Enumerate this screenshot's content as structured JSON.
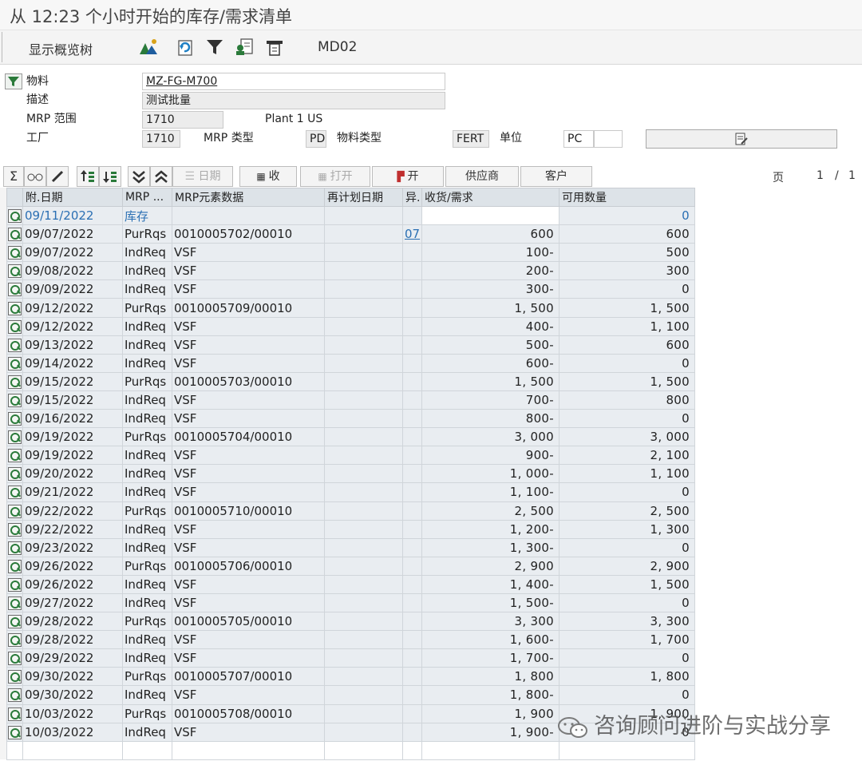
{
  "window": {
    "title": "从 12:23 个小时开始的库存/需求清单"
  },
  "toolbar": {
    "overview_tree": "显示概览树",
    "icons": [
      "overview-icon",
      "refresh-icon",
      "filter-icon",
      "find-icon",
      "print-icon"
    ],
    "tcode": "MD02"
  },
  "header": {
    "material_label": "物料",
    "material_value": "MZ-FG-M700",
    "description_label": "描述",
    "description_value": "测试批量",
    "mrp_area_label": "MRP 范围",
    "mrp_area_value": "1710",
    "mrp_area_text": "Plant 1 US",
    "plant_label": "工厂",
    "plant_value": "1710",
    "mrp_type_label": "MRP 类型",
    "mrp_type_value": "PD",
    "material_type_label": "物料类型",
    "material_type_value": "FERT",
    "unit_label": "单位",
    "unit_value": "PC"
  },
  "grid_toolbar": {
    "sum_icon": "sigma-icon",
    "date_label": "日期",
    "receipts_label": "收",
    "open_label": "打开",
    "open2_label": "开",
    "vendor_label": "供应商",
    "customer_label": "客户",
    "page_label": "页",
    "page_current": "1",
    "page_sep": "/",
    "page_total": "1"
  },
  "columns": {
    "attachment_date": "附.日期",
    "mrp_element": "MRP ...",
    "mrp_data": "MRP元素数据",
    "reschedule": "再计划日期",
    "exception": "异.",
    "receipt_req": "收货/需求",
    "available": "可用数量"
  },
  "rows": [
    {
      "date": "09/11/2022",
      "elem": "库存",
      "data": "",
      "resched": "",
      "exc": "",
      "qty": "",
      "avail": "0"
    },
    {
      "date": "09/07/2022",
      "elem": "PurRqs",
      "data": "0010005702/00010",
      "resched": "",
      "exc": "07",
      "qty": "600",
      "avail": "600"
    },
    {
      "date": "09/07/2022",
      "elem": "IndReq",
      "data": "VSF",
      "resched": "",
      "exc": "",
      "qty": "100-",
      "avail": "500"
    },
    {
      "date": "09/08/2022",
      "elem": "IndReq",
      "data": "VSF",
      "resched": "",
      "exc": "",
      "qty": "200-",
      "avail": "300"
    },
    {
      "date": "09/09/2022",
      "elem": "IndReq",
      "data": "VSF",
      "resched": "",
      "exc": "",
      "qty": "300-",
      "avail": "0"
    },
    {
      "date": "09/12/2022",
      "elem": "PurRqs",
      "data": "0010005709/00010",
      "resched": "",
      "exc": "",
      "qty": "1, 500",
      "avail": "1, 500"
    },
    {
      "date": "09/12/2022",
      "elem": "IndReq",
      "data": "VSF",
      "resched": "",
      "exc": "",
      "qty": "400-",
      "avail": "1, 100"
    },
    {
      "date": "09/13/2022",
      "elem": "IndReq",
      "data": "VSF",
      "resched": "",
      "exc": "",
      "qty": "500-",
      "avail": "600"
    },
    {
      "date": "09/14/2022",
      "elem": "IndReq",
      "data": "VSF",
      "resched": "",
      "exc": "",
      "qty": "600-",
      "avail": "0"
    },
    {
      "date": "09/15/2022",
      "elem": "PurRqs",
      "data": "0010005703/00010",
      "resched": "",
      "exc": "",
      "qty": "1, 500",
      "avail": "1, 500"
    },
    {
      "date": "09/15/2022",
      "elem": "IndReq",
      "data": "VSF",
      "resched": "",
      "exc": "",
      "qty": "700-",
      "avail": "800"
    },
    {
      "date": "09/16/2022",
      "elem": "IndReq",
      "data": "VSF",
      "resched": "",
      "exc": "",
      "qty": "800-",
      "avail": "0"
    },
    {
      "date": "09/19/2022",
      "elem": "PurRqs",
      "data": "0010005704/00010",
      "resched": "",
      "exc": "",
      "qty": "3, 000",
      "avail": "3, 000"
    },
    {
      "date": "09/19/2022",
      "elem": "IndReq",
      "data": "VSF",
      "resched": "",
      "exc": "",
      "qty": "900-",
      "avail": "2, 100"
    },
    {
      "date": "09/20/2022",
      "elem": "IndReq",
      "data": "VSF",
      "resched": "",
      "exc": "",
      "qty": "1, 000-",
      "avail": "1, 100"
    },
    {
      "date": "09/21/2022",
      "elem": "IndReq",
      "data": "VSF",
      "resched": "",
      "exc": "",
      "qty": "1, 100-",
      "avail": "0"
    },
    {
      "date": "09/22/2022",
      "elem": "PurRqs",
      "data": "0010005710/00010",
      "resched": "",
      "exc": "",
      "qty": "2, 500",
      "avail": "2, 500"
    },
    {
      "date": "09/22/2022",
      "elem": "IndReq",
      "data": "VSF",
      "resched": "",
      "exc": "",
      "qty": "1, 200-",
      "avail": "1, 300"
    },
    {
      "date": "09/23/2022",
      "elem": "IndReq",
      "data": "VSF",
      "resched": "",
      "exc": "",
      "qty": "1, 300-",
      "avail": "0"
    },
    {
      "date": "09/26/2022",
      "elem": "PurRqs",
      "data": "0010005706/00010",
      "resched": "",
      "exc": "",
      "qty": "2, 900",
      "avail": "2, 900"
    },
    {
      "date": "09/26/2022",
      "elem": "IndReq",
      "data": "VSF",
      "resched": "",
      "exc": "",
      "qty": "1, 400-",
      "avail": "1, 500"
    },
    {
      "date": "09/27/2022",
      "elem": "IndReq",
      "data": "VSF",
      "resched": "",
      "exc": "",
      "qty": "1, 500-",
      "avail": "0"
    },
    {
      "date": "09/28/2022",
      "elem": "PurRqs",
      "data": "0010005705/00010",
      "resched": "",
      "exc": "",
      "qty": "3, 300",
      "avail": "3, 300"
    },
    {
      "date": "09/28/2022",
      "elem": "IndReq",
      "data": "VSF",
      "resched": "",
      "exc": "",
      "qty": "1, 600-",
      "avail": "1, 700"
    },
    {
      "date": "09/29/2022",
      "elem": "IndReq",
      "data": "VSF",
      "resched": "",
      "exc": "",
      "qty": "1, 700-",
      "avail": "0"
    },
    {
      "date": "09/30/2022",
      "elem": "PurRqs",
      "data": "0010005707/00010",
      "resched": "",
      "exc": "",
      "qty": "1, 800",
      "avail": "1, 800"
    },
    {
      "date": "09/30/2022",
      "elem": "IndReq",
      "data": "VSF",
      "resched": "",
      "exc": "",
      "qty": "1, 800-",
      "avail": "0"
    },
    {
      "date": "10/03/2022",
      "elem": "PurRqs",
      "data": "0010005708/00010",
      "resched": "",
      "exc": "",
      "qty": "1, 900",
      "avail": "1, 900"
    },
    {
      "date": "10/03/2022",
      "elem": "IndReq",
      "data": "VSF",
      "resched": "",
      "exc": "",
      "qty": "1, 900-",
      "avail": "0"
    }
  ],
  "watermark": {
    "text": "咨询顾问进阶与实战分享",
    "icon": "wechat-icon"
  },
  "colors": {
    "link_blue": "#2a6fb3",
    "grid_header": "#dde3e8",
    "grid_cell": "#e9edf1",
    "icon_green": "#2a7a3a"
  }
}
